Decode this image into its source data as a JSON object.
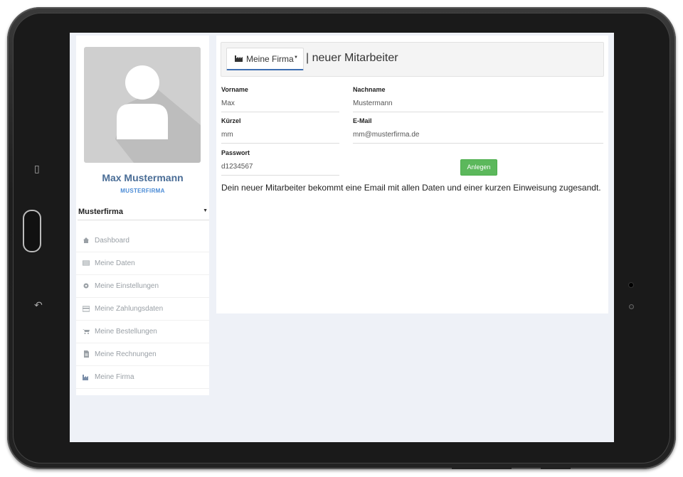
{
  "profile": {
    "name": "Max Mustermann",
    "company": "MUSTERFIRMA"
  },
  "firm_select": {
    "value": "Musterfirma"
  },
  "sidebar": {
    "items": [
      {
        "label": "Dashboard",
        "icon": "home-icon"
      },
      {
        "label": "Meine Daten",
        "icon": "list-icon"
      },
      {
        "label": "Meine Einstellungen",
        "icon": "gear-icon"
      },
      {
        "label": "Meine Zahlungsdaten",
        "icon": "credit-card-icon"
      },
      {
        "label": "Meine Bestellungen",
        "icon": "cart-icon"
      },
      {
        "label": "Meine Rechnungen",
        "icon": "file-icon"
      },
      {
        "label": "Meine Firma",
        "icon": "industry-icon"
      }
    ]
  },
  "header": {
    "firm_button": "Meine Firma",
    "title": "| neuer Mitarbeiter"
  },
  "form": {
    "vorname_label": "Vorname",
    "vorname_value": "Max",
    "nachname_label": "Nachname",
    "nachname_value": "Mustermann",
    "kuerzel_label": "Kürzel",
    "kuerzel_value": "mm",
    "email_label": "E-Mail",
    "email_value": "mm@musterfirma.de",
    "passwort_label": "Passwort",
    "passwort_value": "d1234567",
    "submit_label": "Anlegen"
  },
  "info_text": "Dein neuer Mitarbeiter bekommt eine Email mit allen Daten und einer kurzen Einweisung zugesandt.",
  "colors": {
    "accent": "#4a6d96",
    "success": "#5cb85c",
    "background": "#eef1f7"
  }
}
